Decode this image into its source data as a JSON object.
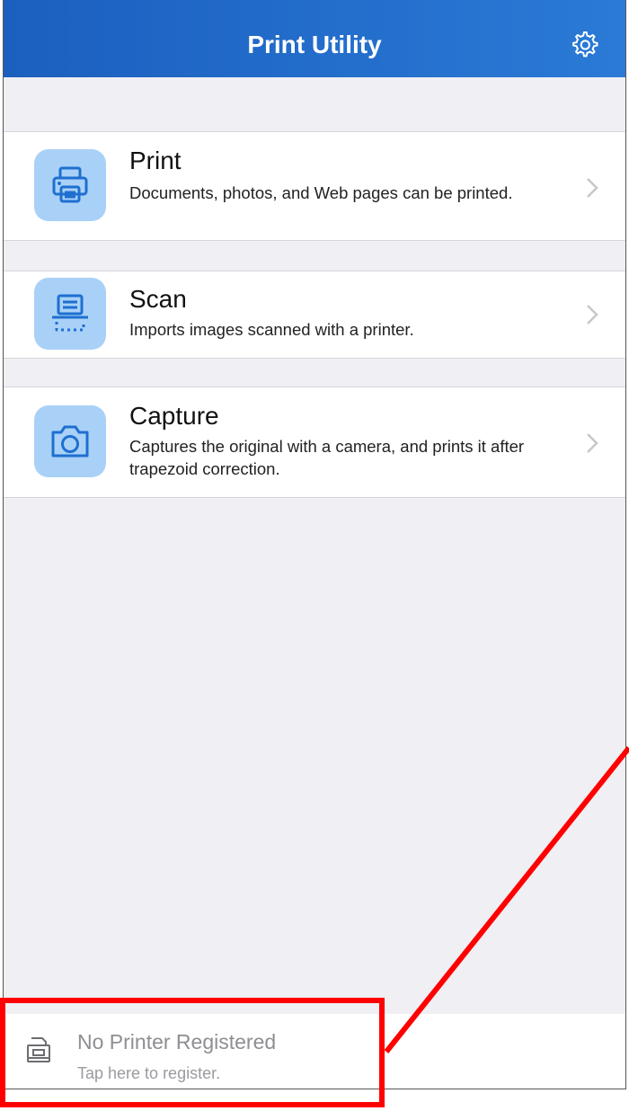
{
  "header": {
    "title": "Print Utility",
    "settings_icon": "gear-icon"
  },
  "menu": [
    {
      "key": "print",
      "title": "Print",
      "description": "Documents, photos, and Web pages can be printed.",
      "icon": "printer-icon"
    },
    {
      "key": "scan",
      "title": "Scan",
      "description": "Imports images scanned with a printer.",
      "icon": "scanner-icon"
    },
    {
      "key": "capture",
      "title": "Capture",
      "description": "Captures the original with a camera, and prints it after trapezoid correction.",
      "icon": "camera-icon"
    }
  ],
  "footer": {
    "title": "No Printer Registered",
    "subtitle": "Tap here to register.",
    "icon": "printer-outline-icon"
  },
  "colors": {
    "navbar": "#1c5fbf",
    "icon_tile": "#a9d1f7",
    "icon_stroke": "#1e6fd0",
    "annotation": "#ff0000"
  }
}
